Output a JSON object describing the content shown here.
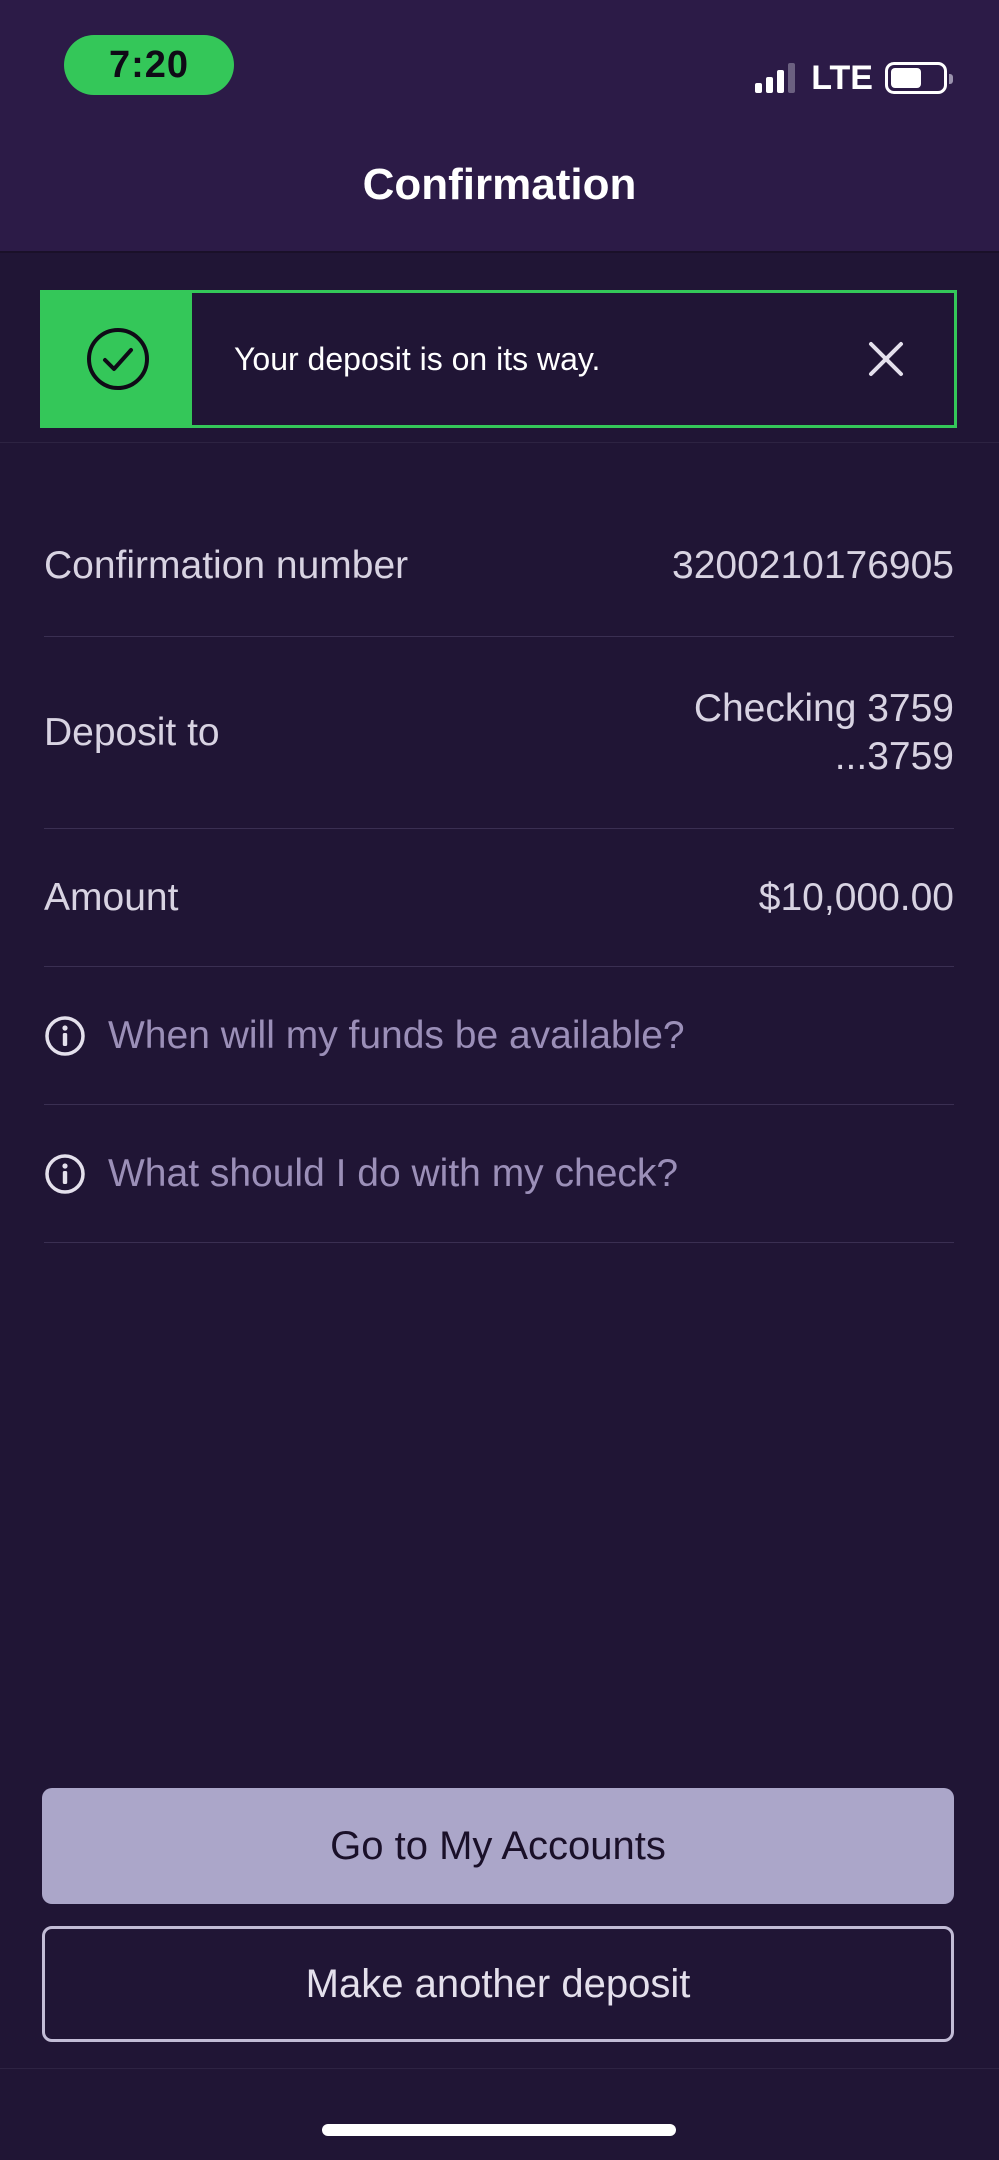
{
  "status_bar": {
    "time": "7:20",
    "network": "LTE",
    "battery_level": 0.6,
    "signal_bars_active": 3
  },
  "header": {
    "title": "Confirmation"
  },
  "banner": {
    "message": "Your deposit is on its way.",
    "icon": "check-circle-icon",
    "close_icon": "close-icon",
    "accent_color": "#34c759"
  },
  "details": {
    "confirmation": {
      "label": "Confirmation number",
      "value": "3200210176905"
    },
    "deposit_to": {
      "label": "Deposit to",
      "value_line1": "Checking 3759",
      "value_line2": "...3759"
    },
    "amount": {
      "label": "Amount",
      "value": "$10,000.00"
    }
  },
  "info_links": [
    {
      "label": "When will my funds be available?",
      "icon": "info-icon"
    },
    {
      "label": "What should I do with my check?",
      "icon": "info-icon"
    }
  ],
  "buttons": {
    "primary": "Go to My Accounts",
    "secondary": "Make another deposit"
  },
  "colors": {
    "background": "#201535",
    "header": "#2c1b47",
    "success": "#34c759",
    "primary_button": "#aba6c9",
    "link_text": "#9b8fb8"
  }
}
